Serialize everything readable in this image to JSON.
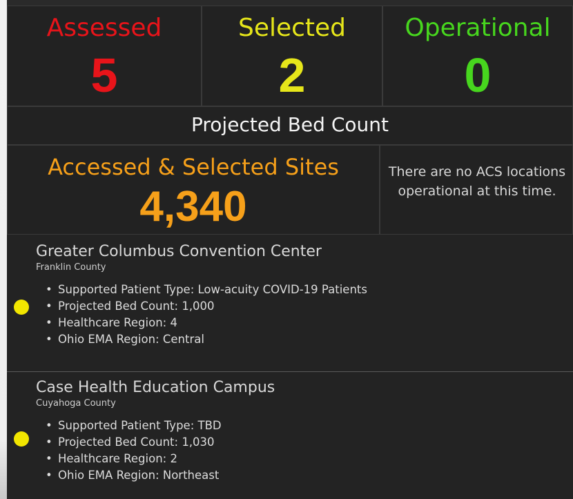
{
  "stats": {
    "assessed": {
      "label": "Assessed",
      "value": "5",
      "color": "#e8141a"
    },
    "selected": {
      "label": "Selected",
      "value": "2",
      "color": "#e6e61a"
    },
    "operational": {
      "label": "Operational",
      "value": "0",
      "color": "#47d61e"
    }
  },
  "bed_count": {
    "title": "Projected Bed Count",
    "sites_label": "Accessed & Selected Sites",
    "sites_value": "4,340",
    "operational_note": "There are no ACS locations operational at this time."
  },
  "sites": [
    {
      "name": "Greater Columbus Convention Center",
      "county": "Franklin County",
      "marker_color": "#f2e600",
      "details": [
        "Supported Patient Type: Low-acuity COVID-19 Patients",
        "Projected Bed Count: 1,000",
        "Healthcare Region: 4",
        "Ohio EMA Region: Central"
      ]
    },
    {
      "name": "Case Health Education Campus",
      "county": "Cuyahoga County",
      "marker_color": "#f2e600",
      "details": [
        "Supported Patient Type: TBD",
        "Projected Bed Count: 1,030",
        "Healthcare Region: 2",
        "Ohio EMA Region: Northeast"
      ]
    }
  ]
}
